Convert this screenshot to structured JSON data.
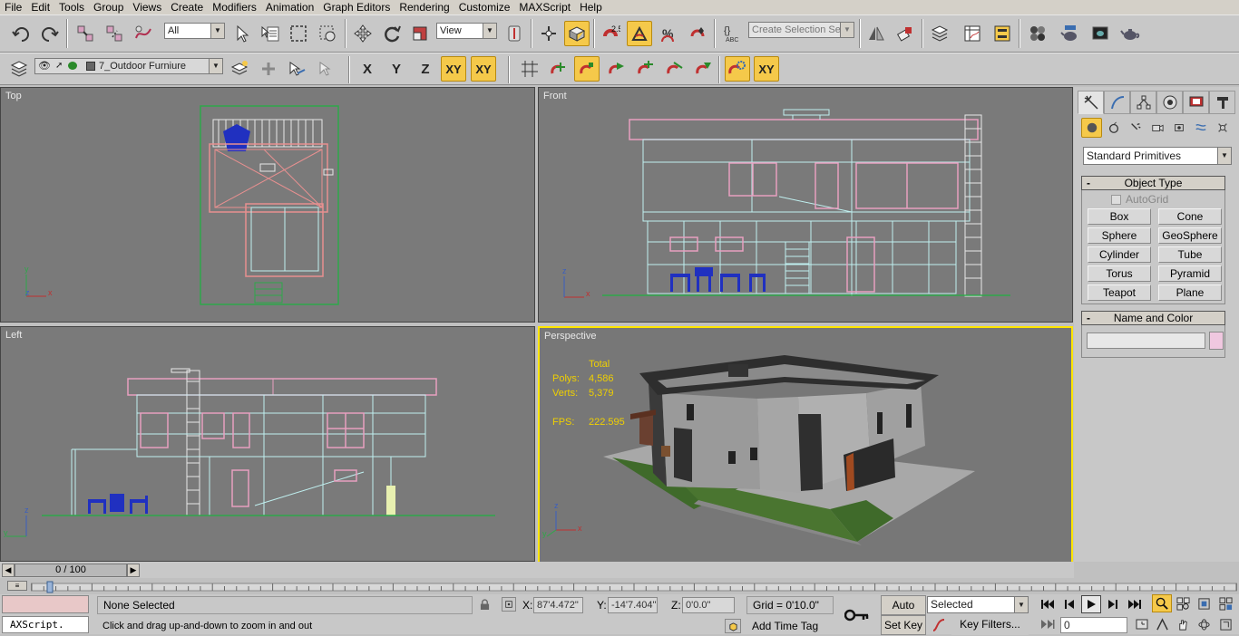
{
  "menu": [
    "File",
    "Edit",
    "Tools",
    "Group",
    "Views",
    "Create",
    "Modifiers",
    "Animation",
    "Graph Editors",
    "Rendering",
    "Customize",
    "MAXScript",
    "Help"
  ],
  "toolbar1": {
    "selection_filter": "All",
    "ref_coord": "View",
    "angle_snap_label": "2.5",
    "named_selection_placeholder": "Create Selection Set"
  },
  "toolbar2": {
    "layer_name": "7_Outdoor Furniure",
    "axis_x": "X",
    "axis_y": "Y",
    "axis_z": "Z",
    "axis_xy": "XY",
    "axis_xy2": "XY"
  },
  "viewports": {
    "top": {
      "label": "Top"
    },
    "front": {
      "label": "Front"
    },
    "left": {
      "label": "Left"
    },
    "perspective": {
      "label": "Perspective",
      "stats": {
        "total_label": "Total",
        "polys_label": "Polys:",
        "polys_value": "4,586",
        "verts_label": "Verts:",
        "verts_value": "5,379",
        "fps_label": "FPS:",
        "fps_value": "222.595"
      }
    }
  },
  "command_panel": {
    "category": "Standard Primitives",
    "object_type_title": "Object Type",
    "autogrid_label": "AutoGrid",
    "buttons": [
      "Box",
      "Cone",
      "Sphere",
      "GeoSphere",
      "Cylinder",
      "Tube",
      "Torus",
      "Pyramid",
      "Teapot",
      "Plane"
    ],
    "name_color_title": "Name and Color",
    "name_value": "",
    "object_color": "#f0c8e0"
  },
  "timeline": {
    "frame_label": "0 / 100",
    "frame_current": 0,
    "frame_total": 100
  },
  "status": {
    "selection": "None Selected",
    "prompt": "Click and drag up-and-down to zoom in and out",
    "maxscript": "AXScript.",
    "x_label": "X:",
    "x_value": "87'4.472\"",
    "y_label": "Y:",
    "y_value": "-14'7.404\"",
    "z_label": "Z:",
    "z_value": "0'0.0\"",
    "grid": "Grid = 0'10.0\"",
    "add_time_tag": "Add Time Tag",
    "auto_key": "Auto Key",
    "set_key": "Set Key",
    "key_mode": "Selected",
    "key_filters": "Key Filters...",
    "current_frame": "0"
  },
  "colors": {
    "accent_active": "#f5c94a",
    "viewport_bg": "#7a7a7a",
    "active_border": "#ffe600",
    "stats_text": "#f0d000"
  }
}
